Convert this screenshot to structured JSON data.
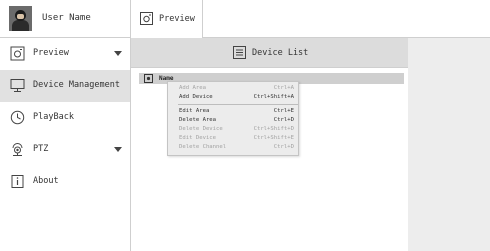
{
  "user": {
    "name": "User Name"
  },
  "sidebar": {
    "items": [
      {
        "label": "Preview",
        "icon": "preview-icon",
        "has_dropdown": true,
        "active": false
      },
      {
        "label": "Device Management",
        "icon": "monitor-icon",
        "has_dropdown": false,
        "active": true
      },
      {
        "label": "PlayBack",
        "icon": "clock-icon",
        "has_dropdown": false,
        "active": false
      },
      {
        "label": "PTZ",
        "icon": "ptz-camera-icon",
        "has_dropdown": true,
        "active": false
      },
      {
        "label": "About",
        "icon": "info-icon",
        "has_dropdown": false,
        "active": false
      }
    ]
  },
  "tabs": [
    {
      "label": "Preview",
      "icon": "preview-icon"
    }
  ],
  "panel": {
    "title": "Device List",
    "icon": "list-icon",
    "tree": [
      {
        "label": "Name",
        "icon": "device-group-icon"
      }
    ]
  },
  "context_menu": {
    "items": [
      {
        "label": "Add Area",
        "shortcut": "Ctrl+A",
        "enabled": false
      },
      {
        "label": "Add Device",
        "shortcut": "Ctrl+Shift+A",
        "enabled": true
      },
      {
        "separator": true
      },
      {
        "label": "Edit Area",
        "shortcut": "Ctrl+E",
        "enabled": true
      },
      {
        "label": "Delete Area",
        "shortcut": "Ctrl+D",
        "enabled": true
      },
      {
        "label": "Delete Device",
        "shortcut": "Ctrl+Shift+D",
        "enabled": false
      },
      {
        "label": "Edit Device",
        "shortcut": "Ctrl+Shift+E",
        "enabled": false
      },
      {
        "label": "Delete Channel",
        "shortcut": "Ctrl+D",
        "enabled": false
      }
    ]
  },
  "colors": {
    "active_item_bg": "#e1e1e1",
    "panel_header_bg": "#dcdcdc",
    "right_panel_bg": "#ededed",
    "menu_bg": "#ececec",
    "disabled_text": "#a3a3a3"
  }
}
